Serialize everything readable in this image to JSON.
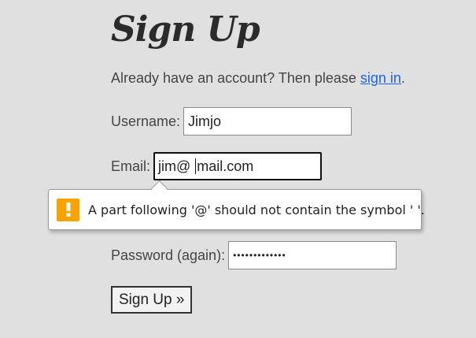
{
  "page": {
    "title": "Sign Up",
    "signin_prompt": "Already have an account? Then please ",
    "signin_link": "sign in",
    "signin_suffix": "."
  },
  "form": {
    "username_label": "Username:",
    "username_value": "Jimjo",
    "email_label": "Email:",
    "email_value_before_caret": "jim@ ",
    "email_value_after_caret": "mail.com",
    "password_again_label": "Password (again):",
    "password_again_value": "•••••••••••••",
    "submit_label": "Sign Up »"
  },
  "validation": {
    "message": "A part following '@' should not contain the symbol ' '.",
    "icon": "warning-icon"
  },
  "colors": {
    "background": "#e0e0e0",
    "link": "#1a66e6",
    "warning": "#f5a300"
  }
}
